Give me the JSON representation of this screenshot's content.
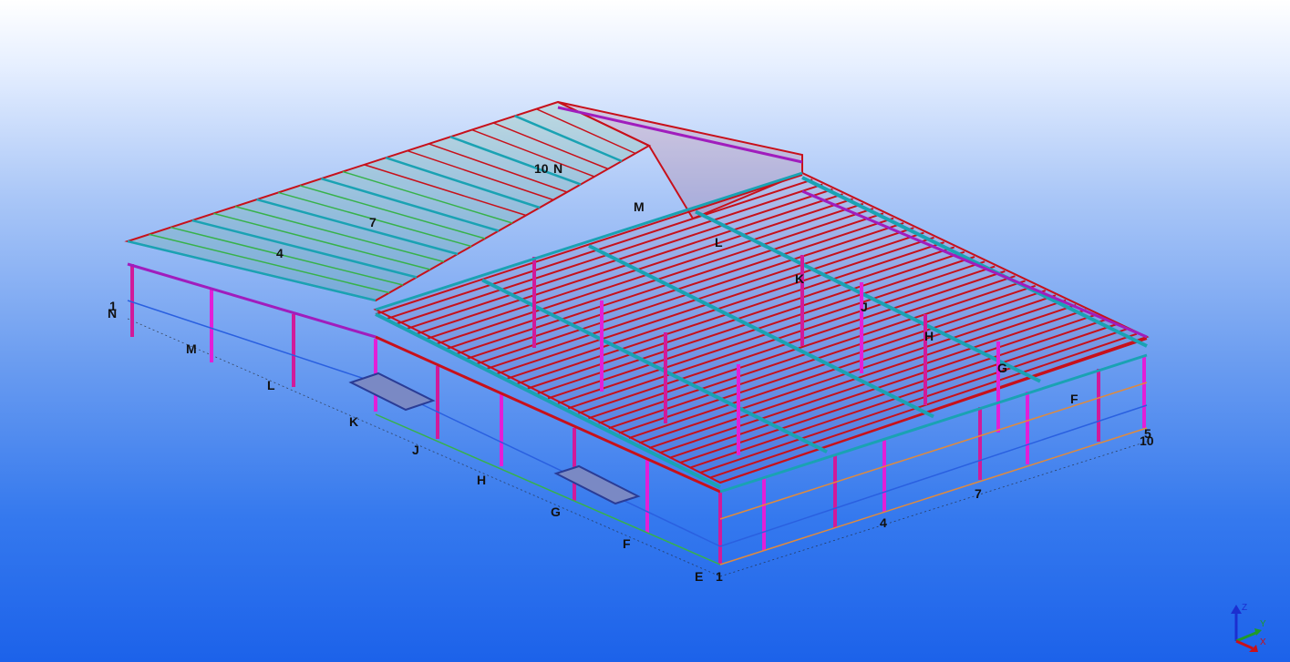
{
  "view": {
    "background_top": "#ffffff",
    "background_bottom": "#1c62ea"
  },
  "colors": {
    "beam": "#c8101a",
    "column": "#e21fd8",
    "girder": "#1aa2b3",
    "bracing": "#37b24a",
    "purlin_secondary": "#e08a3c",
    "edge": "#2a60e0"
  },
  "grid_labels": {
    "left_edge": [
      "N",
      "M",
      "L",
      "K",
      "J",
      "H",
      "G",
      "F",
      "E"
    ],
    "front_edge": [
      "1",
      "4",
      "7",
      "10"
    ],
    "right_edge": [
      "G",
      "F",
      "5",
      "10"
    ],
    "interior": [
      "10",
      "N",
      "7",
      "4",
      "1",
      "M",
      "L",
      "K",
      "J",
      "H"
    ]
  },
  "axis_triad": {
    "x": "X",
    "y": "Y",
    "z": "Z"
  }
}
